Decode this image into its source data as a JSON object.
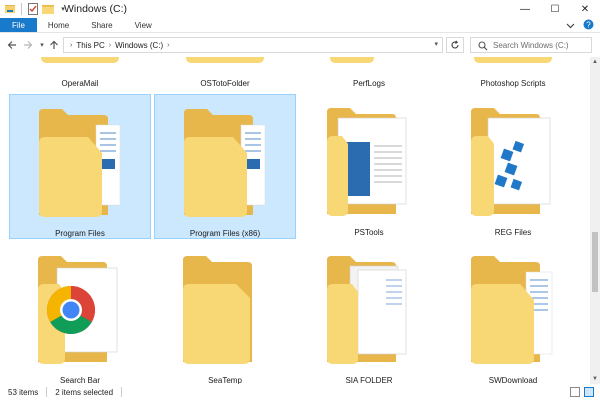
{
  "window": {
    "title": "Windows (C:)",
    "controls": {
      "minimize": "—",
      "maximize": "☐",
      "close": "✕"
    }
  },
  "ribbon": {
    "tabs": [
      {
        "label": "File"
      },
      {
        "label": "Home"
      },
      {
        "label": "Share"
      },
      {
        "label": "View"
      }
    ]
  },
  "address": {
    "crumbs": [
      "This PC",
      "Windows (C:)"
    ],
    "search_placeholder": "Search Windows (C:)"
  },
  "items": [
    {
      "name": "OperaMail",
      "type": "folder-plain",
      "selected": false
    },
    {
      "name": "OSTotoFolder",
      "type": "folder-plain",
      "selected": false
    },
    {
      "name": "PerfLogs",
      "type": "folder-plain",
      "selected": false
    },
    {
      "name": "Photoshop Scripts",
      "type": "folder-plain",
      "selected": false
    },
    {
      "name": "Program Files",
      "type": "folder-docs",
      "selected": true
    },
    {
      "name": "Program Files (x86)",
      "type": "folder-docs",
      "selected": true
    },
    {
      "name": "PSTools",
      "type": "folder-window",
      "selected": false
    },
    {
      "name": "REG Files",
      "type": "folder-reg",
      "selected": false
    },
    {
      "name": "Search Bar",
      "type": "folder-chrome",
      "selected": false
    },
    {
      "name": "SeaTemp",
      "type": "folder-empty",
      "selected": false
    },
    {
      "name": "SIA FOLDER",
      "type": "folder-papers",
      "selected": false
    },
    {
      "name": "SWDownload",
      "type": "folder-docs",
      "selected": false
    }
  ],
  "status": {
    "count": "53 items",
    "selection": "2 items selected"
  },
  "colors": {
    "accent": "#1979ca",
    "selection_bg": "#cce8ff",
    "selection_border": "#99d1ff",
    "folder_back": "#e8b74c",
    "folder_front": "#f8d775"
  }
}
